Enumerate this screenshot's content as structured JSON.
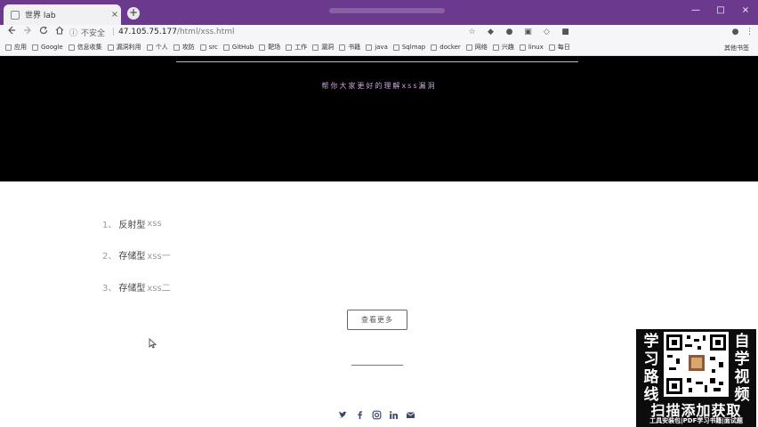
{
  "browser": {
    "tab_title": "世界 lab",
    "tab_close": "×",
    "new_tab": "+",
    "window_controls": [
      "—",
      "□",
      "×"
    ],
    "security_label": "不安全",
    "url_host": "47.105.75.177",
    "url_path": "/html/xss.html",
    "bookmarks": [
      "应用",
      "Google",
      "信息收集",
      "漏洞利用",
      "个人",
      "攻防",
      "src",
      "GitHub",
      "靶场",
      "工作",
      "漏洞",
      "书籍",
      "java",
      "Sqlmap",
      "docker",
      "网络",
      "兴趣",
      "linux",
      "每日"
    ],
    "bookmarks_right": "其他书签"
  },
  "page": {
    "hero_message": "帮你大家更好的理解xss漏洞",
    "links": [
      {
        "number": "1、",
        "label": "反射型",
        "suffix": "xss"
      },
      {
        "number": "2、",
        "label": "存储型",
        "suffix": "xss一"
      },
      {
        "number": "3、",
        "label": "存储型",
        "suffix": "xss二"
      }
    ],
    "more_button": "查看更多"
  },
  "ad": {
    "left_text": [
      "学",
      "习",
      "路",
      "线"
    ],
    "right_text": [
      "自",
      "学",
      "视",
      "频"
    ],
    "scan_text": "扫描添加获取",
    "footer_text": "工具安装包|PDF学习书籍|面试题"
  },
  "colors": {
    "tabbar_bg": "#6b3a8e",
    "hero_bg": "#000000",
    "hero_text": "#c9a8d8"
  }
}
